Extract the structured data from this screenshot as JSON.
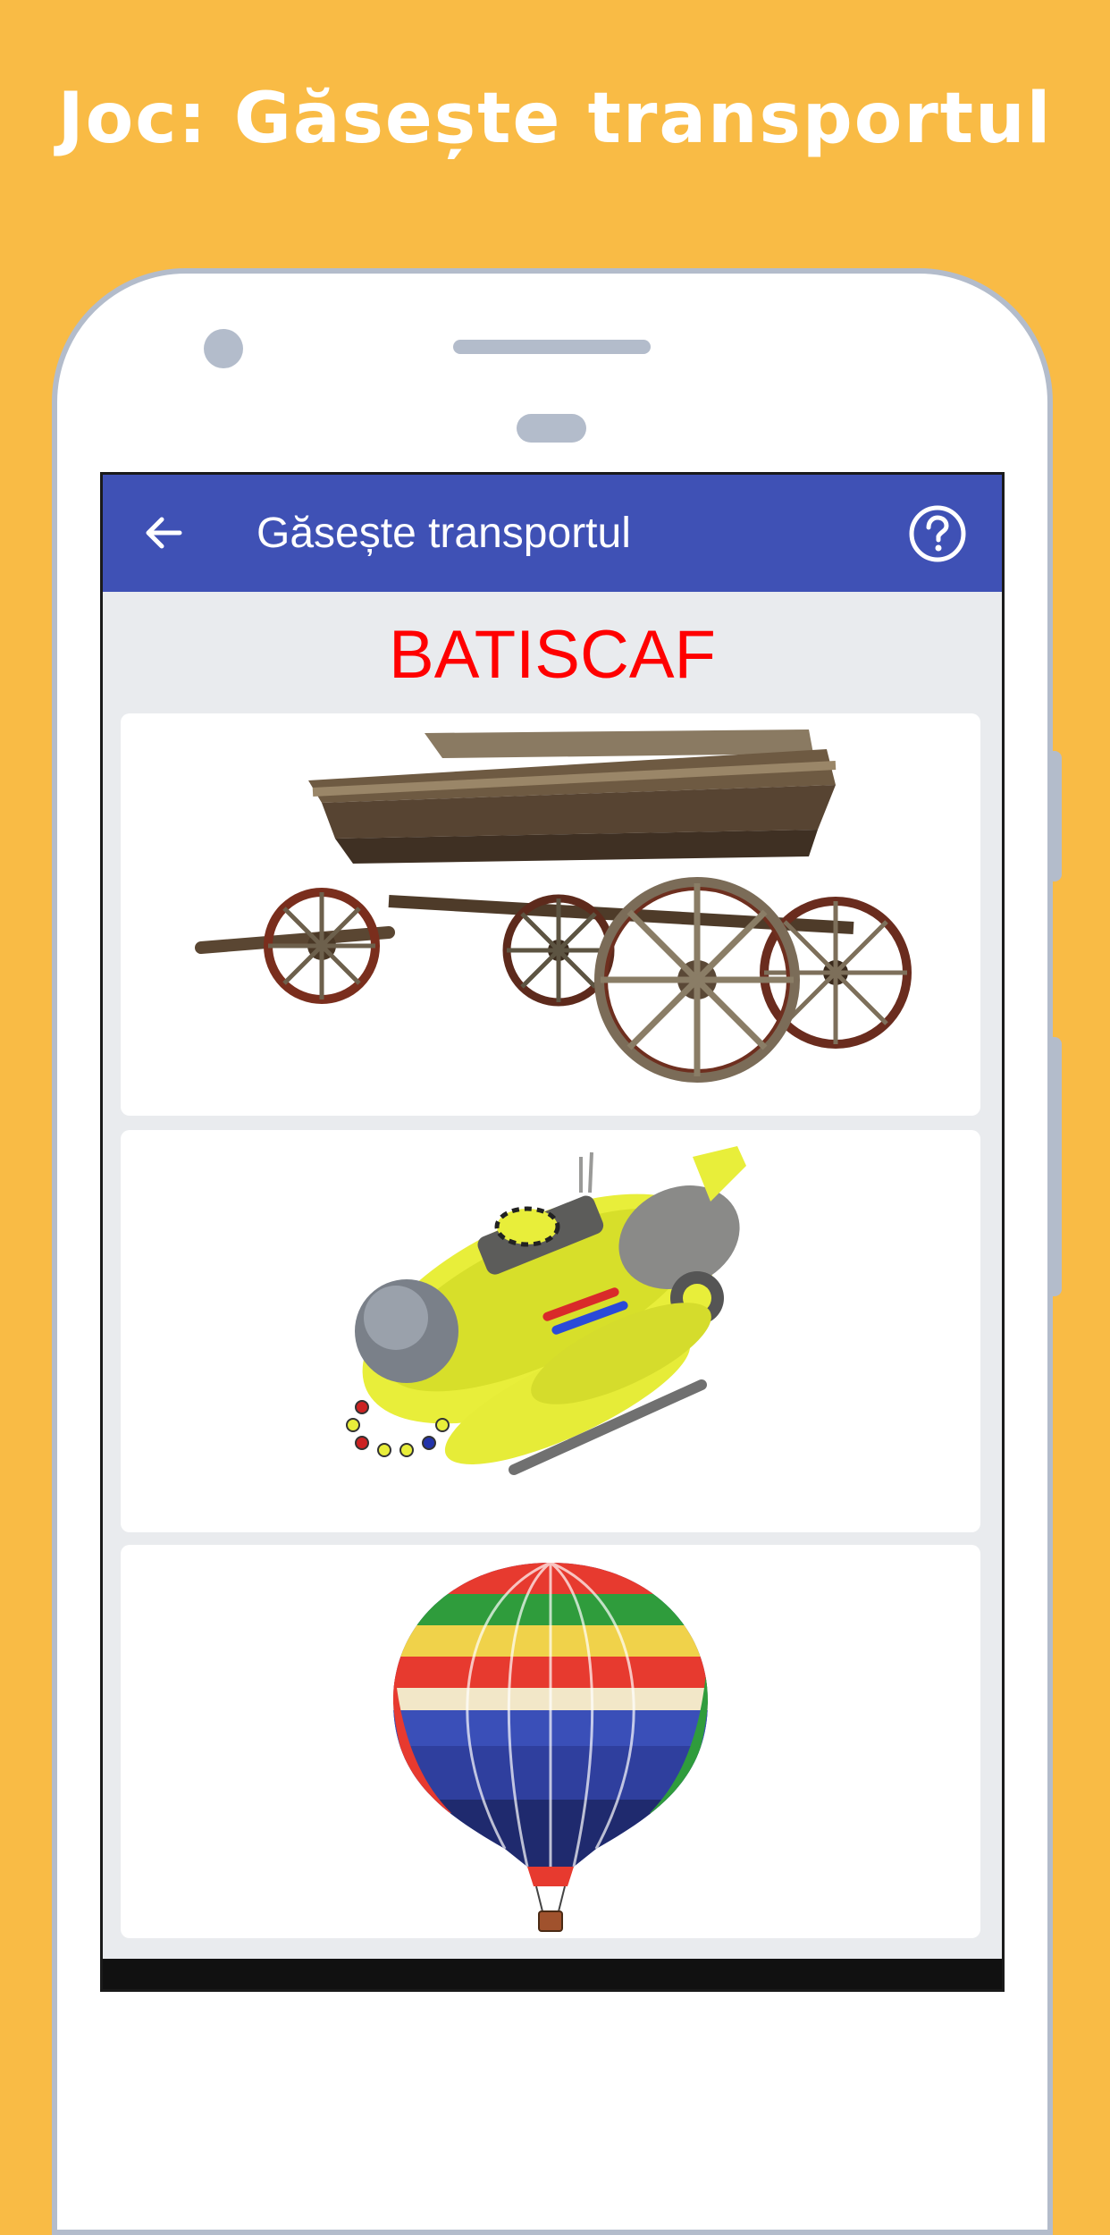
{
  "promo": {
    "title": "Joc: Găsește transportul"
  },
  "app_bar": {
    "title": "Găsește transportul",
    "back_icon": "arrow-back-icon",
    "help_icon": "help-circle-icon",
    "color": "#3f51b5"
  },
  "game": {
    "target_word": "BATISCAF",
    "target_color": "#ff0000",
    "options": [
      {
        "image": "wooden-cart"
      },
      {
        "image": "bathyscaphe-submarine"
      },
      {
        "image": "hot-air-balloon"
      }
    ]
  },
  "colors": {
    "background": "#f9bb45",
    "phone_frame": "#b3bccb",
    "screen_bg": "#e9ebee"
  }
}
